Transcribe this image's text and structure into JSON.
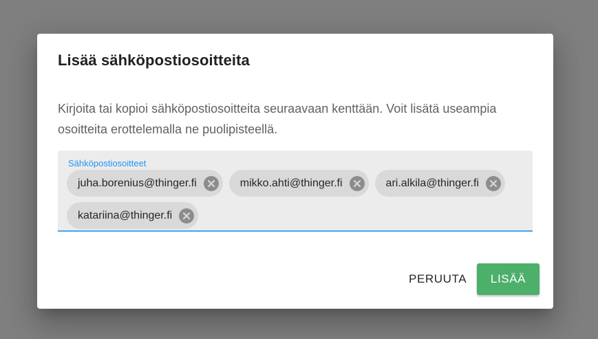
{
  "dialog": {
    "title": "Lisää sähköpostiosoitteita",
    "description": "Kirjoita tai kopioi sähköpostiosoitteita seuraavaan kenttään. Voit lisätä useampia osoitteita erottelemalla ne puolipisteellä.",
    "field": {
      "label": "Sähköpostiosoitteet",
      "chips": [
        {
          "label": "juha.borenius@thinger.fi",
          "remove_icon": "close-circle-icon"
        },
        {
          "label": "mikko.ahti@thinger.fi",
          "remove_icon": "close-circle-icon"
        },
        {
          "label": "ari.alkila@thinger.fi",
          "remove_icon": "close-circle-icon"
        },
        {
          "label": "katariina@thinger.fi",
          "remove_icon": "close-circle-icon"
        }
      ]
    },
    "actions": {
      "cancel_label": "PERUUTA",
      "add_label": "LISÄÄ"
    }
  },
  "colors": {
    "overlay": "#7f7f7f",
    "accent_blue": "#2196f3",
    "add_button_green": "#4caf6a",
    "chip_background": "#d9d9d9",
    "field_background": "#ececec"
  }
}
